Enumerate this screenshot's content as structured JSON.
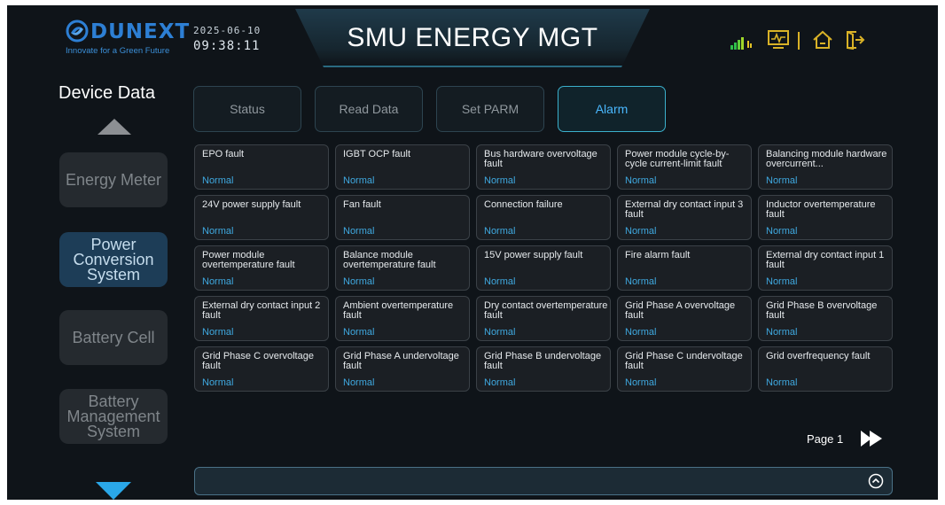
{
  "brand": {
    "name": "DUNEXT",
    "tagline": "Innovate for a Green Future"
  },
  "header": {
    "date": "2025-06-10",
    "time": "09:38:11",
    "title": "SMU ENERGY MGT",
    "icons": [
      "signal-icon",
      "monitor-icon",
      "home-icon",
      "exit-icon"
    ]
  },
  "sidebar": {
    "title": "Device Data",
    "items": [
      {
        "label": "Energy Meter",
        "active": false
      },
      {
        "label": "Power Conversion System",
        "active": true
      },
      {
        "label": "Battery Cell",
        "active": false
      },
      {
        "label": "Battery Management System",
        "active": false
      }
    ]
  },
  "tabs": [
    {
      "label": "Status",
      "active": false
    },
    {
      "label": "Read Data",
      "active": false
    },
    {
      "label": "Set PARM",
      "active": false
    },
    {
      "label": "Alarm",
      "active": true
    }
  ],
  "alarms": [
    {
      "label": "EPO fault",
      "status": "Normal"
    },
    {
      "label": "IGBT OCP fault",
      "status": "Normal"
    },
    {
      "label": "Bus hardware overvoltage fault",
      "status": "Normal"
    },
    {
      "label": "Power module cycle-by-cycle current-limit fault",
      "status": "Normal"
    },
    {
      "label": "Balancing module hardware overcurrent...",
      "status": "Normal"
    },
    {
      "label": "24V power supply fault",
      "status": "Normal"
    },
    {
      "label": "Fan fault",
      "status": "Normal"
    },
    {
      "label": "Connection failure",
      "status": "Normal"
    },
    {
      "label": "External dry contact input 3 fault",
      "status": "Normal"
    },
    {
      "label": "Inductor overtemperature fault",
      "status": "Normal"
    },
    {
      "label": "Power module overtemperature fault",
      "status": "Normal"
    },
    {
      "label": "Balance module overtemperature fault",
      "status": "Normal"
    },
    {
      "label": "15V power supply fault",
      "status": "Normal"
    },
    {
      "label": "Fire alarm fault",
      "status": "Normal"
    },
    {
      "label": "External dry contact input 1 fault",
      "status": "Normal"
    },
    {
      "label": "External dry contact input 2 fault",
      "status": "Normal"
    },
    {
      "label": "Ambient overtemperature fault",
      "status": "Normal"
    },
    {
      "label": "Dry contact overtemperature fault",
      "status": "Normal"
    },
    {
      "label": "Grid Phase A overvoltage fault",
      "status": "Normal"
    },
    {
      "label": "Grid Phase B overvoltage fault",
      "status": "Normal"
    },
    {
      "label": "Grid Phase C overvoltage fault",
      "status": "Normal"
    },
    {
      "label": "Grid Phase A undervoltage fault",
      "status": "Normal"
    },
    {
      "label": "Grid Phase B undervoltage fault",
      "status": "Normal"
    },
    {
      "label": "Grid Phase C undervoltage fault",
      "status": "Normal"
    },
    {
      "label": "Grid overfrequency fault",
      "status": "Normal"
    }
  ],
  "pager": {
    "label": "Page 1"
  },
  "colors": {
    "background": "#0f1419",
    "accent": "#3fa9e0",
    "brand": "#2d7fd4",
    "active_tab": "#4ab8ff"
  }
}
